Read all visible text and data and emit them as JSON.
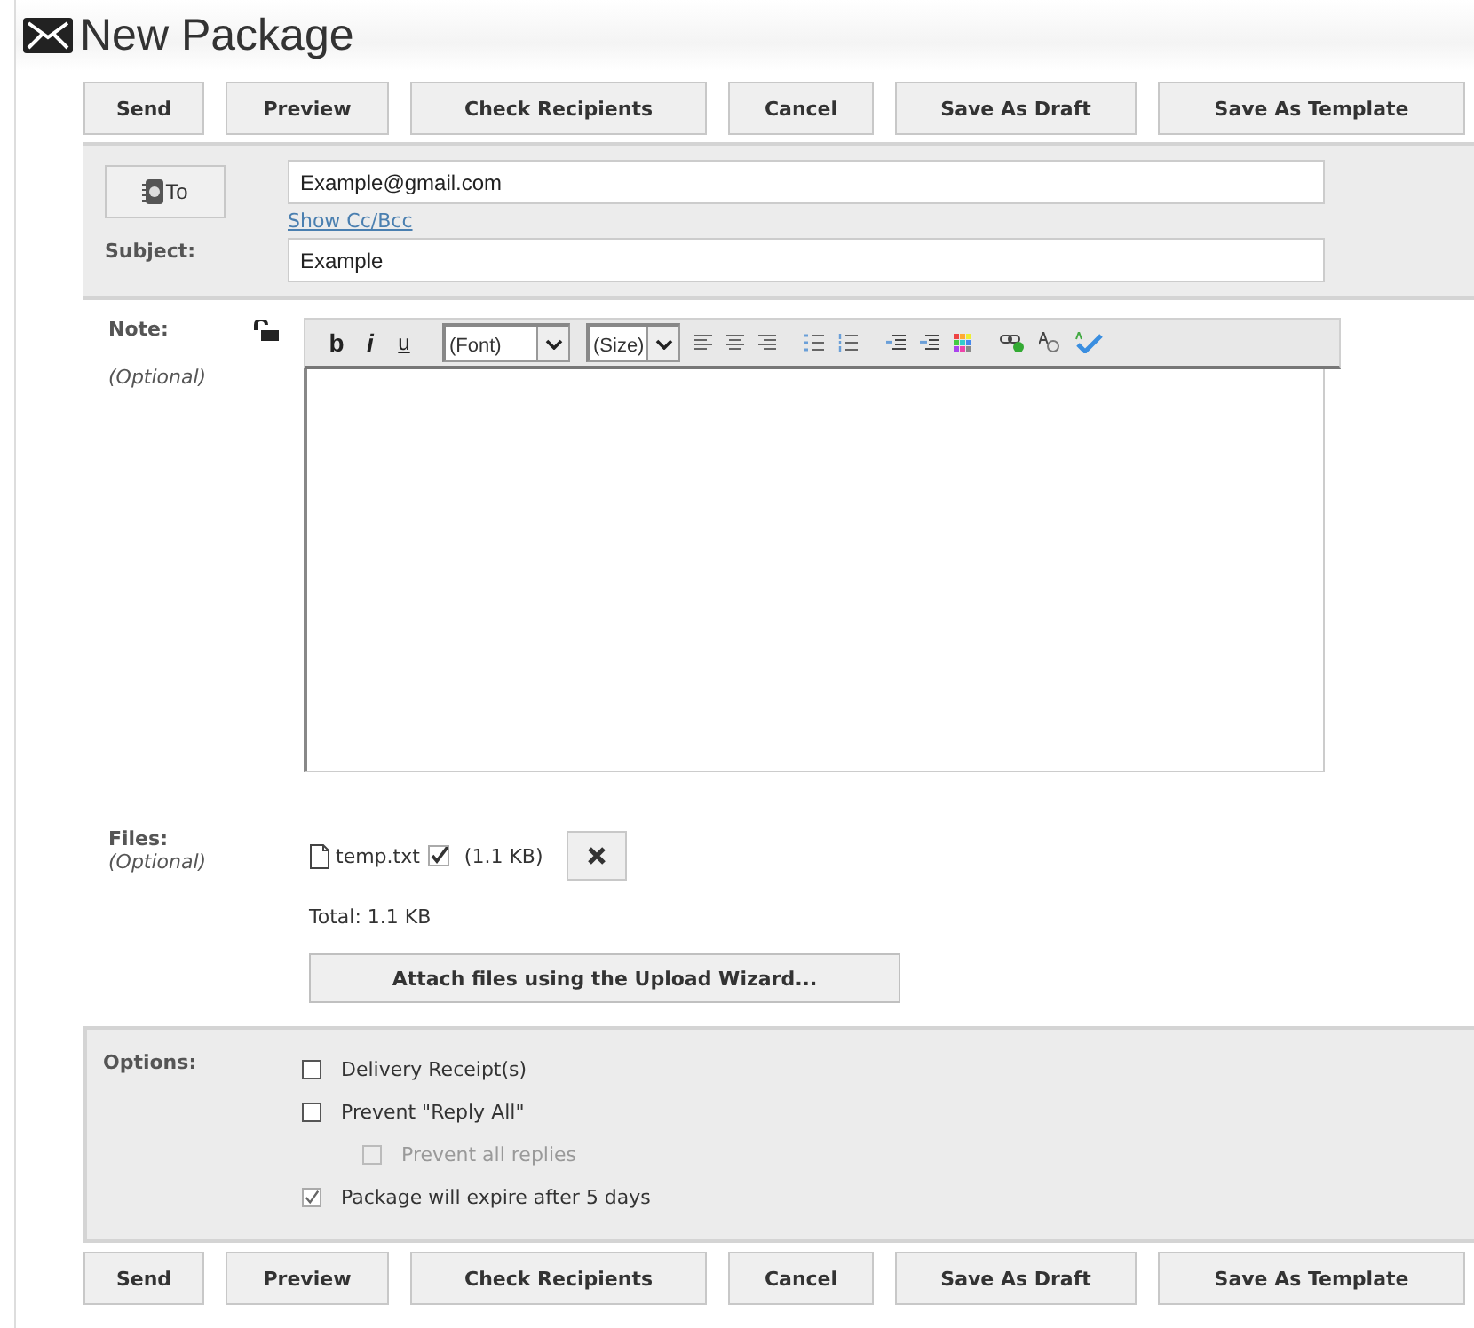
{
  "title": "New Package",
  "top_buttons": [
    "Send",
    "Preview",
    "Check Recipients",
    "Cancel",
    "Save As Draft",
    "Save As Template"
  ],
  "recipients": {
    "to_button": "To",
    "to_value": "Example@gmail.com",
    "cc_link": "Show Cc/Bcc",
    "subject_label": "Subject:",
    "subject_value": "Example"
  },
  "note": {
    "label": "Note:",
    "hint": "(Optional)",
    "locked": false,
    "format_buttons": [
      "b",
      "i",
      "u"
    ],
    "font_select": "(Font)",
    "size_select": "(Size)"
  },
  "files": {
    "label": "Files:",
    "hint": "(Optional)",
    "items": [
      {
        "name": "temp.txt",
        "checked": true,
        "size": "(1.1 KB)"
      }
    ],
    "total": "Total: 1.1 KB",
    "attach_button": "Attach files using the Upload Wizard..."
  },
  "options": {
    "label": "Options:",
    "items": [
      {
        "label": "Delivery Receipt(s)",
        "checked": false,
        "disabled": false
      },
      {
        "label": "Prevent \"Reply All\"",
        "checked": false,
        "disabled": false,
        "children": [
          {
            "label": "Prevent all replies",
            "checked": false,
            "disabled": true
          }
        ]
      },
      {
        "label": "Package will expire after 5 days",
        "checked": true,
        "disabled": false
      }
    ]
  },
  "bottom_buttons": [
    "Send",
    "Preview",
    "Check Recipients",
    "Cancel",
    "Save As Draft",
    "Save As Template"
  ]
}
